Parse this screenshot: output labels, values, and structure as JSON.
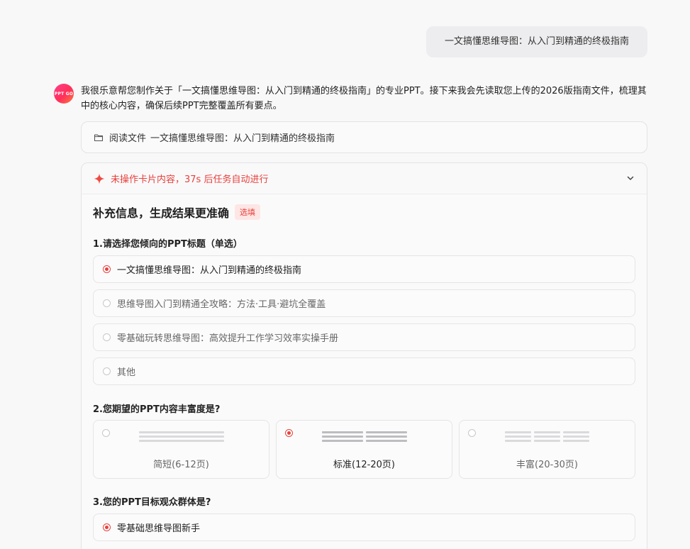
{
  "conversation": {
    "user_message": "一文搞懂思维导图：从入门到精通的终极指南",
    "assistant": {
      "avatar_text": "PPT GO",
      "message": "我很乐意帮您制作关于「一文搞懂思维导图：从入门到精通的终极指南」的专业PPT。接下来我会先读取您上传的2026版指南文件，梳理其中的核心内容，确保后续PPT完整覆盖所有要点。"
    },
    "file_card": {
      "icon": "folder-icon",
      "prefix": "阅读文件",
      "file_name": "一文搞懂思维导图：从入门到精通的终极指南"
    }
  },
  "form": {
    "header": {
      "icon": "spark-icon",
      "countdown_text": "未操作卡片内容，37s 后任务自动进行",
      "expand_icon": "chevron-down-icon"
    },
    "title": "补充信息，生成结果更准确",
    "badge": "选填",
    "q1": {
      "label": "1.请选择您倾向的PPT标题（单选）",
      "options": [
        {
          "label": "一文搞懂思维导图：从入门到精通的终极指南",
          "selected": true
        },
        {
          "label": "思维导图入门到精通全攻略：方法·工具·避坑全覆盖",
          "selected": false
        },
        {
          "label": "零基础玩转思维导图：高效提升工作学习效率实操手册",
          "selected": false
        },
        {
          "label": "其他",
          "selected": false
        }
      ]
    },
    "q2": {
      "label": "2.您期望的PPT内容丰富度是?",
      "options": [
        {
          "label": "简短(6-12页)",
          "selected": false
        },
        {
          "label": "标准(12-20页)",
          "selected": true
        },
        {
          "label": "丰富(20-30页)",
          "selected": false
        }
      ]
    },
    "q3": {
      "label": "3.您的PPT目标观众群体是?",
      "options": [
        {
          "label": "零基础思维导图新手",
          "selected": true
        }
      ]
    }
  },
  "colors": {
    "accent": "#e8413c",
    "page_background": "#f8f8f9",
    "card_border": "#e3e3e6"
  }
}
